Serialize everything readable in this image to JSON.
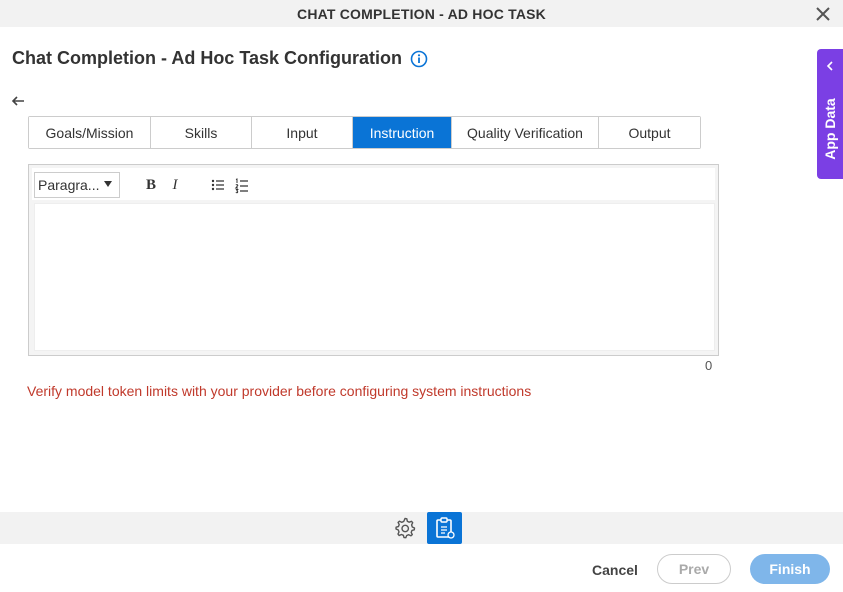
{
  "window": {
    "title": "CHAT COMPLETION - AD HOC TASK"
  },
  "page": {
    "title": "Chat Completion - Ad Hoc Task Configuration"
  },
  "tabs": [
    {
      "label": "Goals/Mission",
      "active": false
    },
    {
      "label": "Skills",
      "active": false
    },
    {
      "label": "Input",
      "active": false
    },
    {
      "label": "Instruction",
      "active": true
    },
    {
      "label": "Quality Verification",
      "active": false
    },
    {
      "label": "Output",
      "active": false
    }
  ],
  "editor": {
    "format_value": "Paragra...",
    "bold_label": "B",
    "italic_label": "I",
    "char_count": "0",
    "content": ""
  },
  "warning_text": "Verify model token limits with your provider before configuring system instructions",
  "footer": {
    "cancel_label": "Cancel",
    "prev_label": "Prev",
    "finish_label": "Finish"
  },
  "side_panel": {
    "label": "App Data"
  },
  "colors": {
    "accent": "#0a74d6",
    "warning": "#c0392b",
    "side_panel": "#7b3fe4",
    "finish_disabled": "#7fb6ea"
  }
}
